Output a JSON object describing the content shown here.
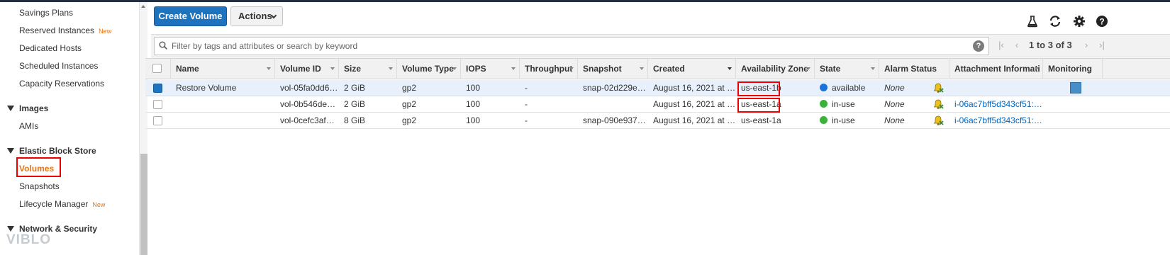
{
  "sidebar": {
    "items": [
      {
        "label": "Savings Plans",
        "new": ""
      },
      {
        "label": "Reserved Instances",
        "new": "New"
      },
      {
        "label": "Dedicated Hosts",
        "new": ""
      },
      {
        "label": "Scheduled Instances",
        "new": ""
      },
      {
        "label": "Capacity Reservations",
        "new": ""
      }
    ],
    "images": {
      "heading": "Images",
      "items": [
        "AMIs"
      ]
    },
    "ebs": {
      "heading": "Elastic Block Store",
      "volumes": "Volumes",
      "snapshots": "Snapshots",
      "lifecycle": "Lifecycle Manager",
      "lifecycle_new": "New"
    },
    "network": {
      "heading": "Network & Security"
    },
    "watermark": "VIBLO"
  },
  "toolbar": {
    "create_label": "Create Volume",
    "actions_label": "Actions"
  },
  "filter": {
    "placeholder": "Filter by tags and attributes or search by keyword",
    "help": "?"
  },
  "pager": {
    "text": "1 to 3 of 3"
  },
  "table": {
    "columns": [
      "Name",
      "Volume ID",
      "Size",
      "Volume Type",
      "IOPS",
      "Throughput",
      "Snapshot",
      "Created",
      "Availability Zone",
      "State",
      "Alarm Status",
      "Attachment Informati",
      "Monitoring"
    ],
    "rows": [
      {
        "name": "Restore Volume",
        "volume_id": "vol-05fa0dd6…",
        "size": "2 GiB",
        "type": "gp2",
        "iops": "100",
        "throughput": "-",
        "snapshot": "snap-02d229e…",
        "created": "August 16, 2021 at …",
        "az": "us-east-1b",
        "state": "available",
        "alarm": "None",
        "attachment": "",
        "selected": true
      },
      {
        "name": "",
        "volume_id": "vol-0b546de…",
        "size": "2 GiB",
        "type": "gp2",
        "iops": "100",
        "throughput": "-",
        "snapshot": "",
        "created": "August 16, 2021 at …",
        "az": "us-east-1a",
        "state": "in-use",
        "alarm": "None",
        "attachment": "i-06ac7bff5d343cf51:…",
        "selected": false
      },
      {
        "name": "",
        "volume_id": "vol-0cefc3af…",
        "size": "8 GiB",
        "type": "gp2",
        "iops": "100",
        "throughput": "-",
        "snapshot": "snap-090e937…",
        "created": "August 16, 2021 at …",
        "az": "us-east-1a",
        "state": "in-use",
        "alarm": "None",
        "attachment": "i-06ac7bff5d343cf51:…",
        "selected": false
      }
    ]
  },
  "colors": {
    "primary": "#1e73be",
    "accent_orange": "#ec7211",
    "available": "#1a73d9",
    "in_use": "#3bb33b",
    "highlight": "#e00000"
  },
  "icons": [
    "flask-icon",
    "refresh-icon",
    "gear-icon",
    "help-icon",
    "search-icon",
    "bell-icon",
    "chevron-down-icon"
  ]
}
